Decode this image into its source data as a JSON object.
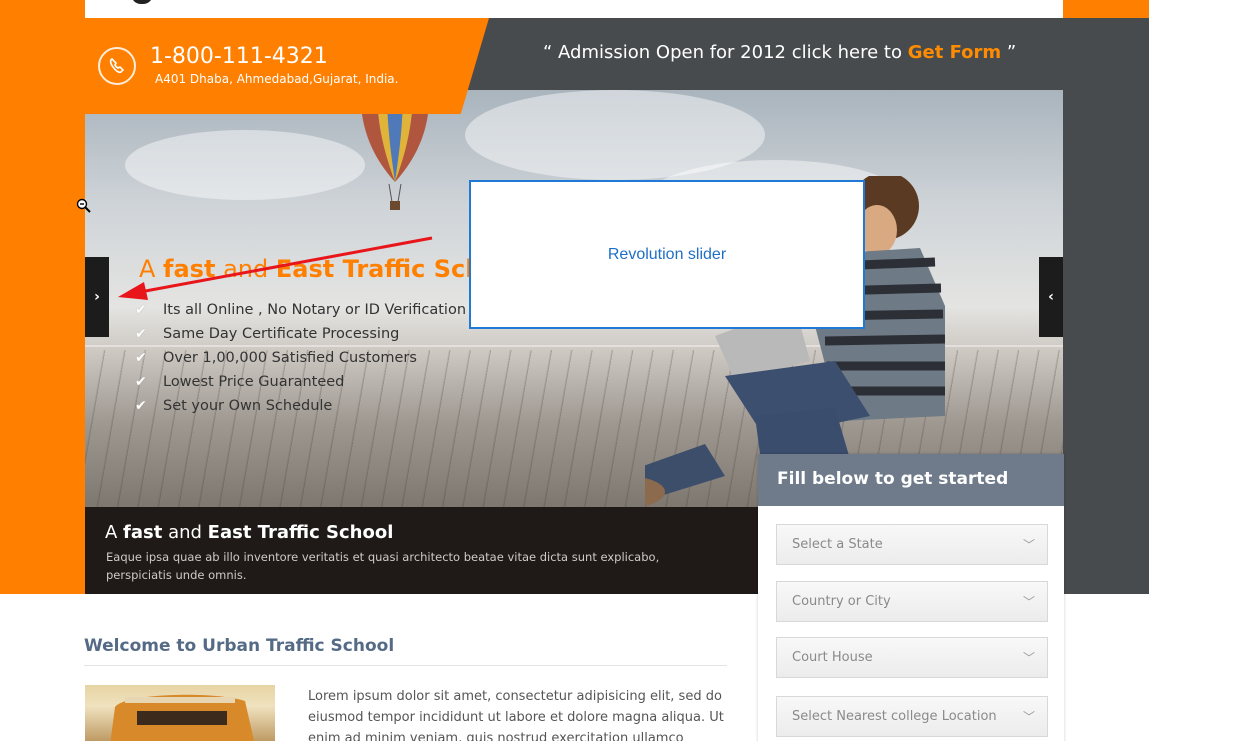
{
  "header": {
    "phone": "1-800-111-4321",
    "address": "A401  Dhaba, Ahmedabad,Gujarat, India.",
    "admission_prefix": "“ Admission Open for 2012 click here to ",
    "admission_link": "Get Form",
    "admission_suffix": " ”"
  },
  "hero": {
    "title_a": "A ",
    "title_fast": "fast",
    "title_and": " and ",
    "title_rest": "East Traffic Sch",
    "features": [
      "Its all Online , No Notary or ID Verification R",
      "Same Day Certificate Processing",
      "Over 1,00,000 Satisfied Customers",
      "Lowest Price Guaranteed",
      "Set your Own Schedule"
    ],
    "next_arrow": "›",
    "prev_arrow": "‹",
    "caption": {
      "a": "A ",
      "fast": "fast",
      "and": " and ",
      "rest": "East Traffic School",
      "text": "Eaque ipsa quae ab illo inventore veritatis et quasi architecto beatae vitae dicta sunt explicabo, perspiciatis unde omnis."
    }
  },
  "annotation": {
    "label": "Revolution slider",
    "box_color": "#1e7ad6",
    "arrow_color": "#e8161b"
  },
  "form": {
    "title": "Fill below to get started",
    "fields": [
      "Select a State",
      "Country or City",
      "Court House",
      "Select Nearest college Location"
    ]
  },
  "welcome": {
    "title": "Welcome to Urban Traffic School",
    "body": "Lorem ipsum dolor sit amet, consectetur adipisicing elit, sed do eiusmod tempor incididunt ut labore et dolore magna aliqua. Ut enim ad minim veniam, quis nostrud exercitation ullamco laboris"
  },
  "colors": {
    "orange": "#ff7f00",
    "dark": "#474b4e",
    "form_header": "#6f7b8a"
  }
}
